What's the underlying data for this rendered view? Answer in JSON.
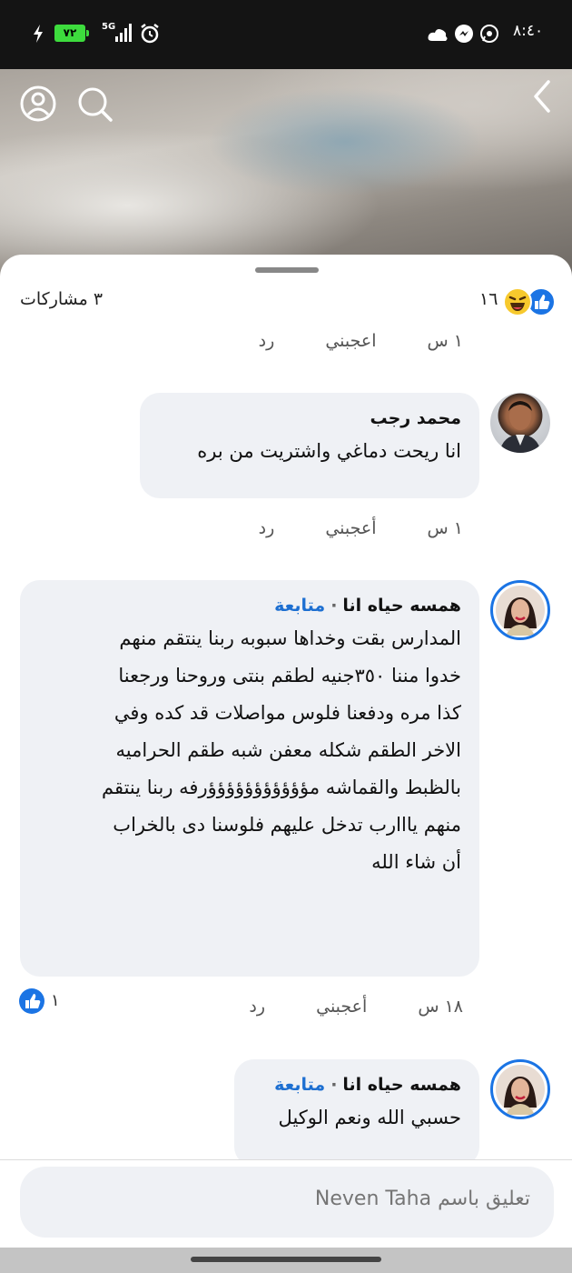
{
  "status_bar": {
    "time": "٨:٤٠",
    "battery": "٧٢",
    "network": "5G"
  },
  "reactions": {
    "count": "١٦",
    "shares": "٣ مشاركات",
    "icons": [
      "like-icon",
      "haha-icon"
    ]
  },
  "partial_comment": {
    "time": "١ س",
    "like_label": "اعجبني",
    "reply_label": "رد"
  },
  "comments": [
    {
      "author": "محمد رجب",
      "following": "",
      "text": [
        "انا ريحت دماغي واشتريت من بره"
      ],
      "time": "١ س",
      "like_label": "أعجبني",
      "reply_label": "رد",
      "like_count": ""
    },
    {
      "author": "همسه حياه انا",
      "following": "متابعة",
      "text": [
        "المدارس بقت وخداها سبوبه ربنا ينتقم منهم",
        "خدوا مننا ٣٥٠جنيه لطقم بنتى وروحنا ورجعنا",
        "كذا مره ودفعنا فلوس مواصلات قد كده وفي",
        "الاخر الطقم شكله معفن شبه طقم الحراميه",
        "بالظبط والقماشه مؤؤؤؤؤؤؤؤؤؤؤرفه ربنا ينتقم",
        "منهم يااارب تدخل عليهم فلوسنا دى بالخراب",
        "أن شاء الله"
      ],
      "time": "١٨ س",
      "like_label": "أعجبني",
      "reply_label": "رد",
      "like_count": "١"
    },
    {
      "author": "همسه حياه انا",
      "following": "متابعة",
      "text": [
        "حسبي الله ونعم الوكيل"
      ],
      "time": "",
      "like_label": "",
      "reply_label": "",
      "like_count": ""
    }
  ],
  "composer": {
    "placeholder": "تعليق باسم Neven Taha"
  },
  "colors": {
    "accent": "#1b74e4",
    "follow": "#1d6fd1",
    "bubble": "#eff1f5"
  }
}
